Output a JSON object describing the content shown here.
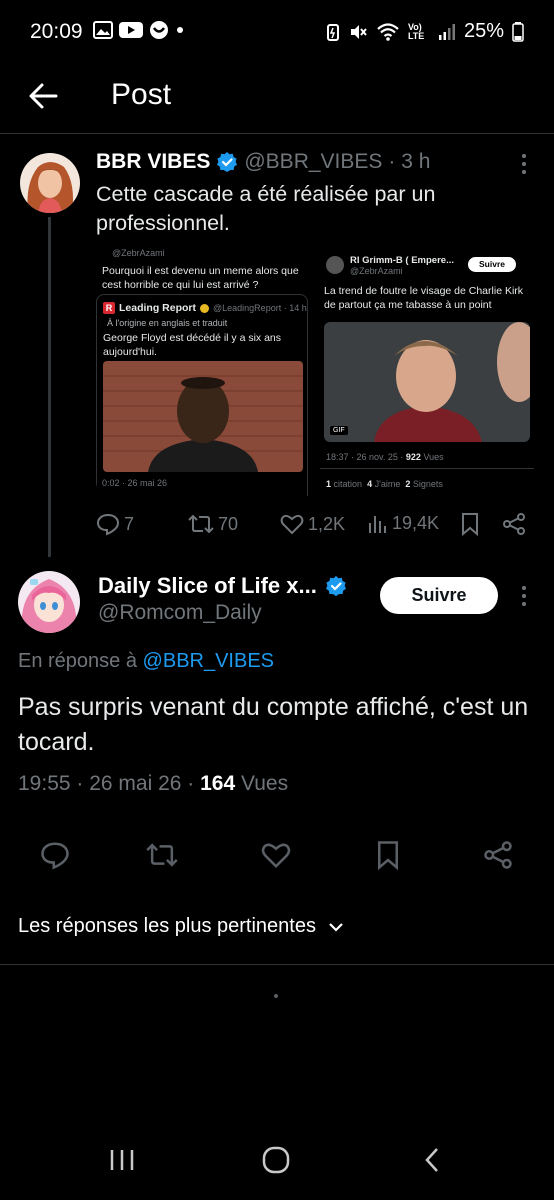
{
  "status_bar": {
    "time": "20:09",
    "battery": "25%",
    "network": "Vo) LTE"
  },
  "header": {
    "title": "Post"
  },
  "tweet": {
    "name": "BBR VIBES",
    "handle": "@BBR_VIBES",
    "time": "· 3 h",
    "text": "Cette cascade a été réalisée par un professionnel.",
    "stats": {
      "replies": "7",
      "reposts": "70",
      "likes": "1,2K",
      "views": "19,4K"
    },
    "media": {
      "left": {
        "handle_top": "@ZebrAzami",
        "text": "Pourquoi il est devenu un meme alors que cest horrible ce qui lui est arrivé ?",
        "quoted_name": "Leading Report",
        "quoted_handle": "@LeadingReport · 14 h",
        "translated": "À l'origine en anglais et traduit",
        "quoted_text": "George Floyd est décédé il y a six ans aujourd'hui.",
        "date": "0:02 · 26 mai 26"
      },
      "right": {
        "name": "RI Grimm-B ( Empere...",
        "handle": "@ZebrAzami",
        "follow": "Suivre",
        "text": "La trend de foutre le visage de Charlie Kirk de partout ça me tabasse à un point",
        "gif": "GIF",
        "meta": "18:37 · 26 nov. 25 ·",
        "views": "922",
        "views_label": "Vues",
        "citation": "1",
        "citation_label": "citation",
        "likes": "4",
        "likes_label": "J'aime",
        "bookmarks": "2",
        "bookmarks_label": "Signets"
      }
    }
  },
  "reply": {
    "name": "Daily Slice of Life x...",
    "handle": "@Romcom_Daily",
    "follow_label": "Suivre",
    "reply_prefix": "En réponse à",
    "reply_to": "@BBR_VIBES",
    "text": "Pas surpris venant du compte affiché, c'est un tocard.",
    "time": "19:55 · 26 mai 26 ·",
    "views_count": "164",
    "views_label": "Vues"
  },
  "relevance_label": "Les réponses les plus pertinentes",
  "colors": {
    "background": "#000000",
    "text": "#e7e9ea",
    "muted": "#71767b",
    "accent": "#1d9bf0",
    "divider": "#2f3336"
  }
}
